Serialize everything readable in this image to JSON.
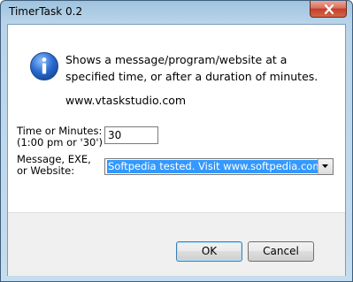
{
  "window": {
    "title": "TimerTask 0.2"
  },
  "message": {
    "text": "Shows a message/program/website at a specified time, or after a duration of minutes.",
    "website": "www.vtaskstudio.com"
  },
  "form": {
    "time_label": "Time or Minutes:\n(1:00 pm or '30')",
    "time_value": "30",
    "message_label": "Message, EXE,\nor Website:",
    "message_value": "Softpedia tested. Visit www.softpedia.com"
  },
  "buttons": {
    "ok": "OK",
    "cancel": "Cancel"
  },
  "icons": {
    "info": "info-icon",
    "close": "close-icon",
    "dropdown": "chevron-down-icon"
  },
  "colors": {
    "selection": "#3399ff",
    "info_icon": "#2a6ad2",
    "close_button": "#c3402b"
  }
}
